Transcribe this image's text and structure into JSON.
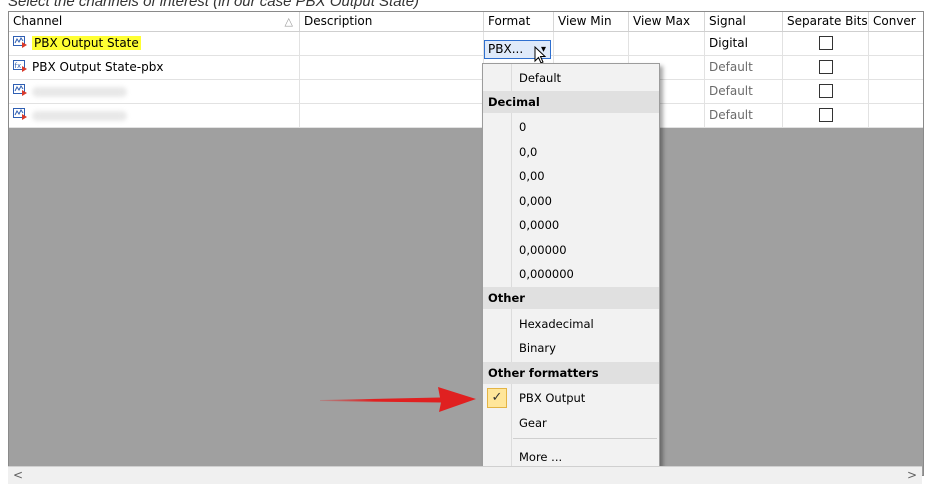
{
  "caption": "Select the channels of interest (in our case PBX Output State)",
  "columns": {
    "channel": "Channel",
    "description": "Description",
    "format": "Format",
    "view_min": "View Min",
    "view_max": "View Max",
    "signal": "Signal",
    "separate_bits": "Separate Bits",
    "conversion": "Conver"
  },
  "sort_indicator": "△",
  "rows": [
    {
      "channel": "PBX Output State",
      "icon": "analog-channel-icon",
      "signal": "Digital"
    },
    {
      "channel": "PBX Output State-pbx",
      "icon": "expression-channel-icon",
      "signal": "Default"
    },
    {
      "channel": "",
      "icon": "analog-channel-icon",
      "signal": "Default"
    },
    {
      "channel": "",
      "icon": "analog-channel-icon",
      "signal": "Default"
    }
  ],
  "format_button": {
    "label": "PBX...",
    "arrow": "▾"
  },
  "menu": {
    "default": "Default",
    "decimal_header": "Decimal",
    "decimal": [
      "0",
      "0,0",
      "0,00",
      "0,000",
      "0,0000",
      "0,00000",
      "0,000000"
    ],
    "other_header": "Other",
    "other": [
      "Hexadecimal",
      "Binary"
    ],
    "other_formatters_header": "Other formatters",
    "formatters": [
      "PBX Output",
      "Gear"
    ],
    "checked": "✓",
    "more": "More ..."
  },
  "scrollbar": {
    "left": "<",
    "right": ">"
  },
  "colors": {
    "highlight": "#ffff33",
    "annotation_arrow": "#e02020",
    "grid_bg": "#a0a0a0"
  }
}
